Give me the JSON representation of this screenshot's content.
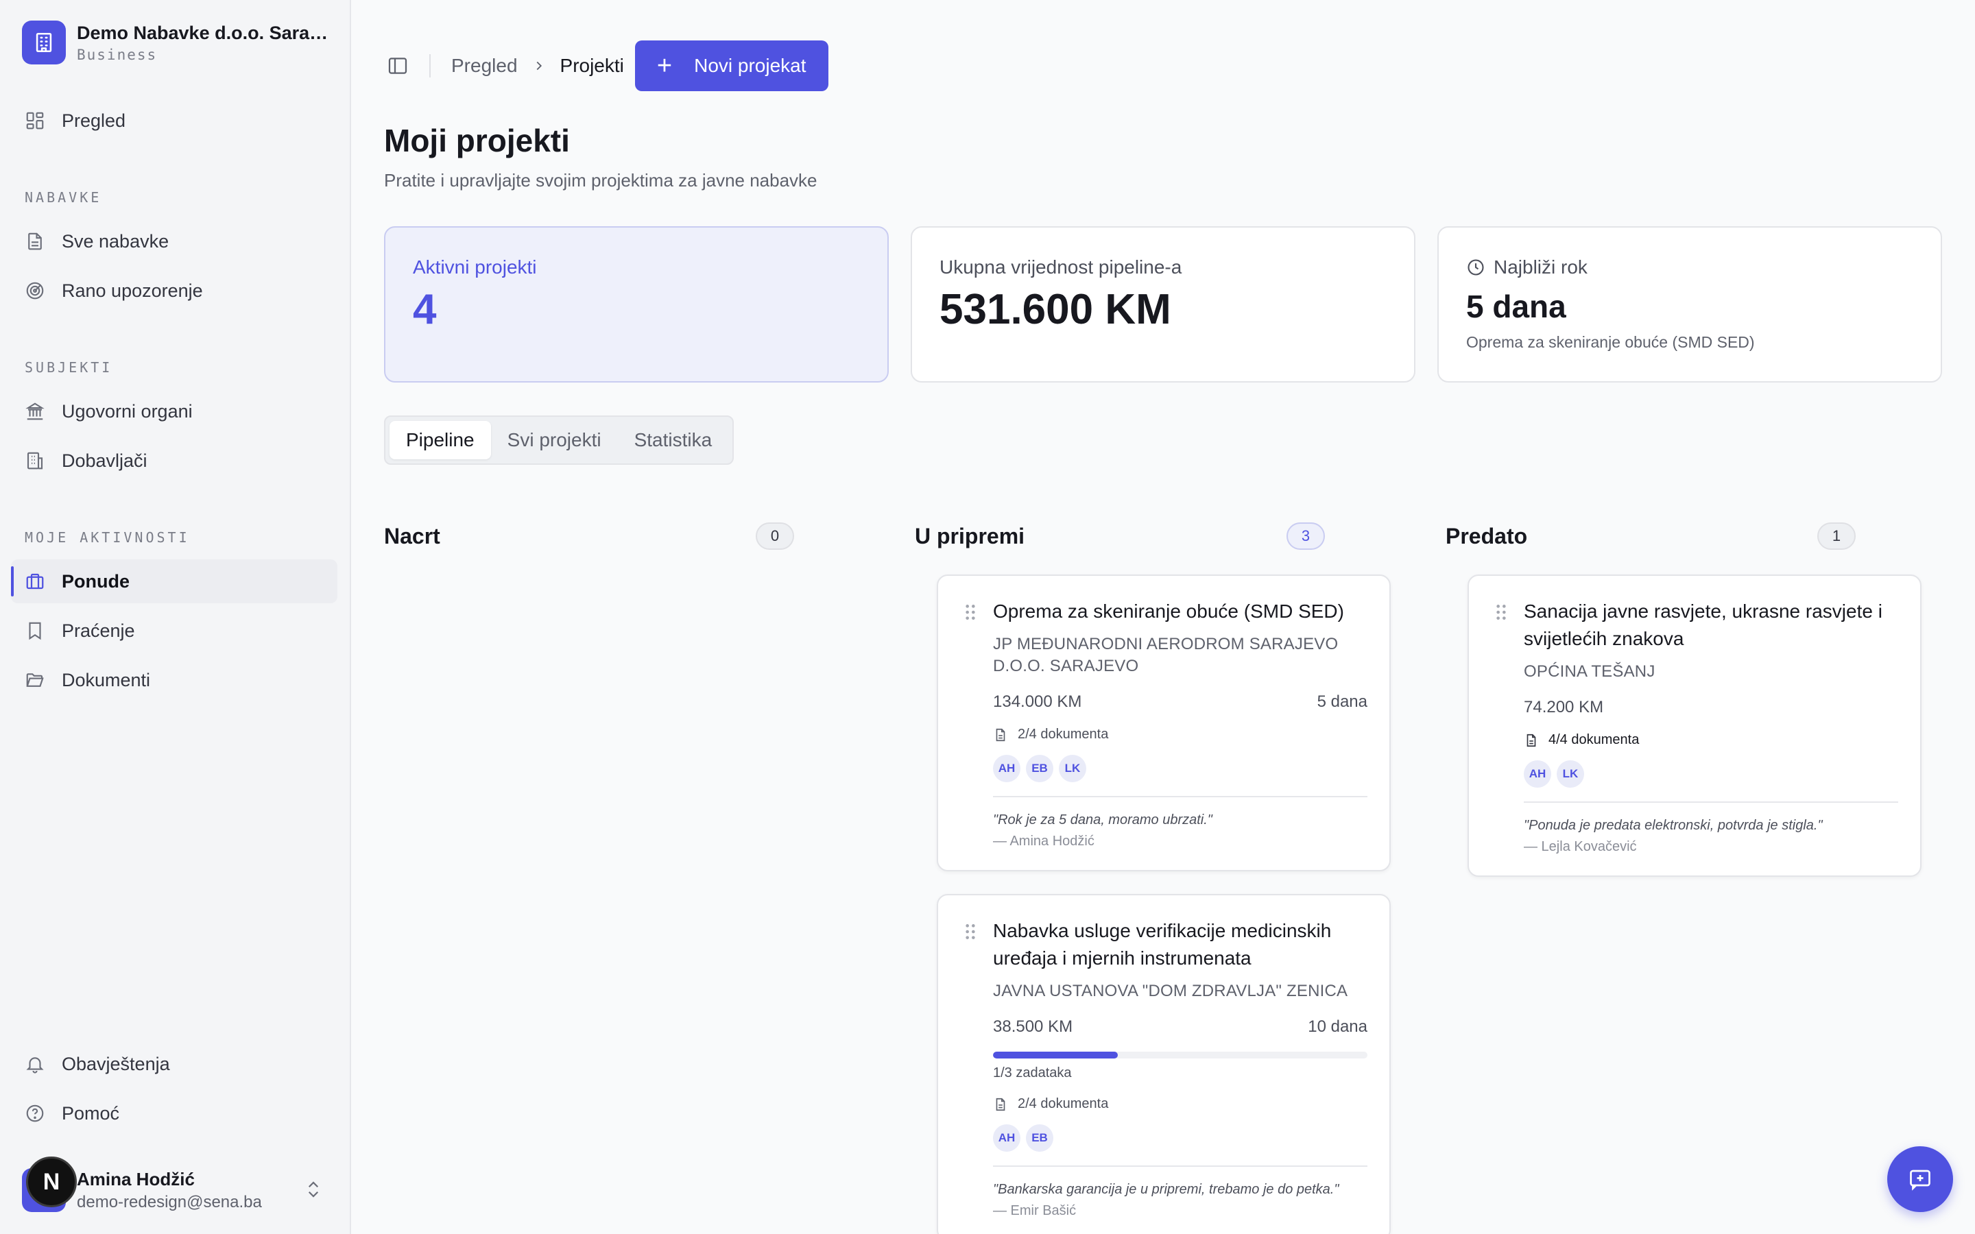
{
  "sidebar": {
    "org_name": "Demo Nabavke d.o.o. Sarajevo",
    "org_plan": "Business",
    "overview": "Pregled",
    "sections": {
      "nabavke": "NABAVKE",
      "subjekti": "SUBJEKTI",
      "aktivnosti": "MOJE AKTIVNOSTI"
    },
    "items": {
      "sve_nabavke": "Sve nabavke",
      "rano_upozorenje": "Rano upozorenje",
      "ugovorni_organi": "Ugovorni organi",
      "dobavljaci": "Dobavljači",
      "ponude": "Ponude",
      "pracenje": "Praćenje",
      "dokumenti": "Dokumenti",
      "obavjestenja": "Obavještenja",
      "pomoc": "Pomoć"
    },
    "user": {
      "name": "Amina Hodžić",
      "email": "demo-redesign@sena.ba",
      "badge": "N"
    }
  },
  "header": {
    "breadcrumb_root": "Pregled",
    "breadcrumb_current": "Projekti",
    "new_project": "Novi projekat"
  },
  "page": {
    "title": "Moji projekti",
    "subtitle": "Pratite i upravljajte svojim projektima za javne nabavke"
  },
  "stats": {
    "active": {
      "label": "Aktivni projekti",
      "value": "4"
    },
    "pipeline": {
      "label": "Ukupna vrijednost pipeline-a",
      "value": "531.600 KM"
    },
    "deadline": {
      "label": "Najbliži rok",
      "value": "5 dana",
      "sub": "Oprema za skeniranje obuće (SMD SED)"
    }
  },
  "tabs": [
    "Pipeline",
    "Svi projekti",
    "Statistika"
  ],
  "columns": [
    {
      "title": "Nacrt",
      "count": "0"
    },
    {
      "title": "U pripremi",
      "count": "3"
    },
    {
      "title": "Predato",
      "count": "1"
    }
  ],
  "cards": {
    "c1": {
      "title": "Oprema za skeniranje obuće (SMD SED)",
      "org": "JP MEĐUNARODNI AERODROM SARAJEVO D.O.O. SARAJEVO",
      "value": "134.000 KM",
      "deadline": "5 dana",
      "docs": "2/4 dokumenta",
      "avatars": [
        "AH",
        "EB",
        "LK"
      ],
      "quote": "\"Rok je za 5 dana, moramo ubrzati.\"",
      "author": "— Amina Hodžić"
    },
    "c2": {
      "title": "Nabavka usluge verifikacije medicinskih uređaja i mjernih instrumenata",
      "org": "JAVNA USTANOVA \"DOM ZDRAVLJA\" ZENICA",
      "value": "38.500 KM",
      "deadline": "10 dana",
      "progress_fraction": 0.333,
      "progress_label": "1/3 zadataka",
      "docs": "2/4 dokumenta",
      "avatars": [
        "AH",
        "EB"
      ],
      "quote": "\"Bankarska garancija je u pripremi, trebamo je do petka.\"",
      "author": "— Emir Bašić"
    },
    "c3": {
      "title": "Sanacija javne rasvjete, ukrasne rasvjete i svijetlećih znakova",
      "org": "OPĆINA TEŠANJ",
      "value": "74.200 KM",
      "docs": "4/4 dokumenta",
      "avatars": [
        "AH",
        "LK"
      ],
      "quote": "\"Ponuda je predata elektronski, potvrda je stigla.\"",
      "author": "— Lejla Kovačević"
    }
  },
  "colors": {
    "accent": "#4f52e0",
    "sidebar_bg": "#f4f5f7",
    "page_bg": "#f9fafb"
  }
}
